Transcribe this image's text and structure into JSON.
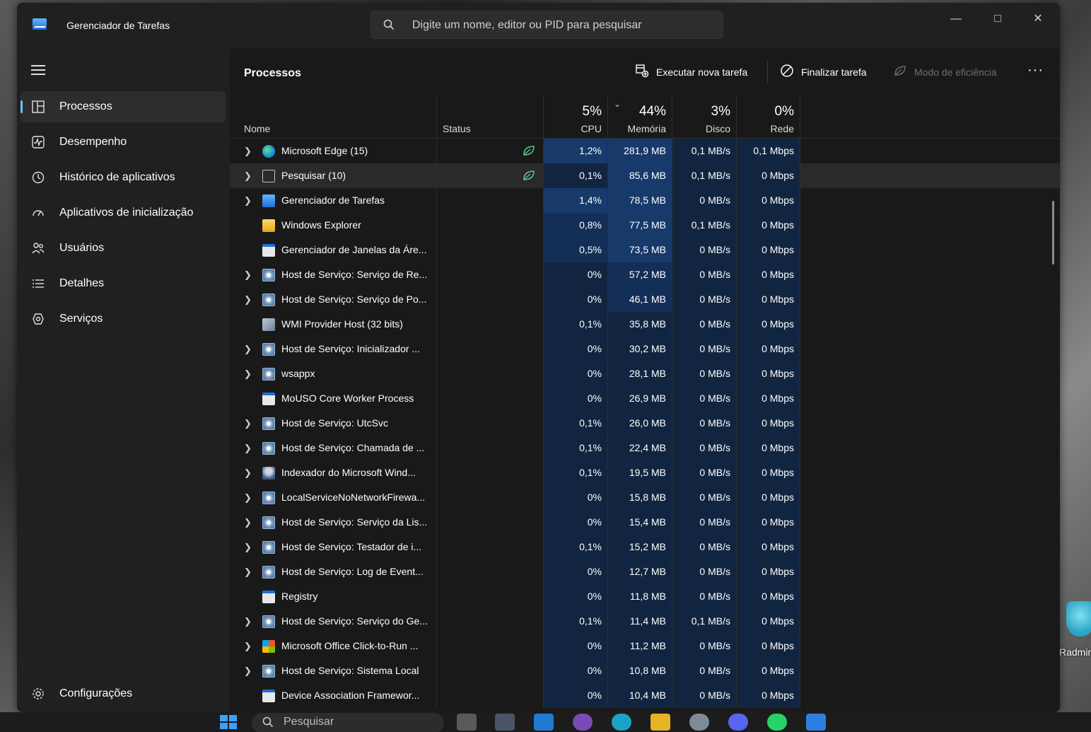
{
  "window": {
    "title": "Gerenciador de Tarefas",
    "search_placeholder": "Digite um nome, editor ou PID para pesquisar"
  },
  "sidebar": {
    "items": [
      {
        "label": "Processos",
        "icon": "grid-icon"
      },
      {
        "label": "Desempenho",
        "icon": "performance-icon"
      },
      {
        "label": "Histórico de aplicativos",
        "icon": "history-icon"
      },
      {
        "label": "Aplicativos de inicialização",
        "icon": "startup-icon"
      },
      {
        "label": "Usuários",
        "icon": "users-icon"
      },
      {
        "label": "Detalhes",
        "icon": "details-icon"
      },
      {
        "label": "Serviços",
        "icon": "services-icon"
      }
    ],
    "settings_label": "Configurações"
  },
  "toolbar": {
    "page_title": "Processos",
    "run_new_task": "Executar nova tarefa",
    "end_task": "Finalizar tarefa",
    "efficiency_mode": "Modo de eficiência",
    "more": "···"
  },
  "table": {
    "headers": {
      "name": "Nome",
      "status": "Status",
      "cpu_pct": "5%",
      "cpu": "CPU",
      "mem_pct": "44%",
      "mem": "Memória",
      "disk_pct": "3%",
      "disk": "Disco",
      "net_pct": "0%",
      "net": "Rede"
    },
    "rows": [
      {
        "expand": true,
        "icon": "edge-icon",
        "name": "Microsoft Edge (15)",
        "leaf": true,
        "cpu": "1,2%",
        "mem": "281,9 MB",
        "disk": "0,1 MB/s",
        "net": "0,1 Mbps"
      },
      {
        "expand": true,
        "icon": "search-app-icon",
        "name": "Pesquisar (10)",
        "leaf": true,
        "cpu": "0,1%",
        "mem": "85,6 MB",
        "disk": "0,1 MB/s",
        "net": "0 Mbps"
      },
      {
        "expand": true,
        "icon": "taskmgr-icon",
        "name": "Gerenciador de Tarefas",
        "leaf": false,
        "cpu": "1,4%",
        "mem": "78,5 MB",
        "disk": "0 MB/s",
        "net": "0 Mbps"
      },
      {
        "expand": false,
        "icon": "folder-icon",
        "name": "Windows Explorer",
        "leaf": false,
        "cpu": "0,8%",
        "mem": "77,5 MB",
        "disk": "0,1 MB/s",
        "net": "0 Mbps"
      },
      {
        "expand": false,
        "icon": "window-icon",
        "name": "Gerenciador de Janelas da Áre...",
        "leaf": false,
        "cpu": "0,5%",
        "mem": "73,5 MB",
        "disk": "0 MB/s",
        "net": "0 Mbps"
      },
      {
        "expand": true,
        "icon": "service-gear-icon",
        "name": "Host de Serviço: Serviço de Re...",
        "leaf": false,
        "cpu": "0%",
        "mem": "57,2 MB",
        "disk": "0 MB/s",
        "net": "0 Mbps"
      },
      {
        "expand": true,
        "icon": "service-gear-icon",
        "name": "Host de Serviço: Serviço de Po...",
        "leaf": false,
        "cpu": "0%",
        "mem": "46,1 MB",
        "disk": "0 MB/s",
        "net": "0 Mbps"
      },
      {
        "expand": false,
        "icon": "wmi-icon",
        "name": "WMI Provider Host (32 bits)",
        "leaf": false,
        "cpu": "0,1%",
        "mem": "35,8 MB",
        "disk": "0 MB/s",
        "net": "0 Mbps"
      },
      {
        "expand": true,
        "icon": "service-gear-icon",
        "name": "Host de Serviço: Inicializador ...",
        "leaf": false,
        "cpu": "0%",
        "mem": "30,2 MB",
        "disk": "0 MB/s",
        "net": "0 Mbps"
      },
      {
        "expand": true,
        "icon": "service-gear-icon",
        "name": "wsappx",
        "leaf": false,
        "cpu": "0%",
        "mem": "28,1 MB",
        "disk": "0 MB/s",
        "net": "0 Mbps"
      },
      {
        "expand": false,
        "icon": "window-icon",
        "name": "MoUSO Core Worker Process",
        "leaf": false,
        "cpu": "0%",
        "mem": "26,9 MB",
        "disk": "0 MB/s",
        "net": "0 Mbps"
      },
      {
        "expand": true,
        "icon": "service-gear-icon",
        "name": "Host de Serviço: UtcSvc",
        "leaf": false,
        "cpu": "0,1%",
        "mem": "26,0 MB",
        "disk": "0 MB/s",
        "net": "0 Mbps"
      },
      {
        "expand": true,
        "icon": "service-gear-icon",
        "name": "Host de Serviço: Chamada de ...",
        "leaf": false,
        "cpu": "0,1%",
        "mem": "22,4 MB",
        "disk": "0 MB/s",
        "net": "0 Mbps"
      },
      {
        "expand": true,
        "icon": "indexer-icon",
        "name": "Indexador do Microsoft Wind...",
        "leaf": false,
        "cpu": "0,1%",
        "mem": "19,5 MB",
        "disk": "0 MB/s",
        "net": "0 Mbps"
      },
      {
        "expand": true,
        "icon": "service-gear-icon",
        "name": "LocalServiceNoNetworkFirewa...",
        "leaf": false,
        "cpu": "0%",
        "mem": "15,8 MB",
        "disk": "0 MB/s",
        "net": "0 Mbps"
      },
      {
        "expand": true,
        "icon": "service-gear-icon",
        "name": "Host de Serviço: Serviço da Lis...",
        "leaf": false,
        "cpu": "0%",
        "mem": "15,4 MB",
        "disk": "0 MB/s",
        "net": "0 Mbps"
      },
      {
        "expand": true,
        "icon": "service-gear-icon",
        "name": "Host de Serviço: Testador de i...",
        "leaf": false,
        "cpu": "0,1%",
        "mem": "15,2 MB",
        "disk": "0 MB/s",
        "net": "0 Mbps"
      },
      {
        "expand": true,
        "icon": "service-gear-icon",
        "name": "Host de Serviço: Log de Event...",
        "leaf": false,
        "cpu": "0%",
        "mem": "12,7 MB",
        "disk": "0 MB/s",
        "net": "0 Mbps"
      },
      {
        "expand": false,
        "icon": "window-icon",
        "name": "Registry",
        "leaf": false,
        "cpu": "0%",
        "mem": "11,8 MB",
        "disk": "0 MB/s",
        "net": "0 Mbps"
      },
      {
        "expand": true,
        "icon": "service-gear-icon",
        "name": "Host de Serviço: Serviço do Ge...",
        "leaf": false,
        "cpu": "0,1%",
        "mem": "11,4 MB",
        "disk": "0,1 MB/s",
        "net": "0 Mbps"
      },
      {
        "expand": true,
        "icon": "office-icon",
        "name": "Microsoft Office Click-to-Run ...",
        "leaf": false,
        "cpu": "0%",
        "mem": "11,2 MB",
        "disk": "0 MB/s",
        "net": "0 Mbps"
      },
      {
        "expand": true,
        "icon": "service-gear-icon",
        "name": "Host de Serviço: Sistema Local",
        "leaf": false,
        "cpu": "0%",
        "mem": "10,8 MB",
        "disk": "0 MB/s",
        "net": "0 Mbps"
      },
      {
        "expand": false,
        "icon": "window-icon",
        "name": "Device Association Framewor...",
        "leaf": false,
        "cpu": "0%",
        "mem": "10,4 MB",
        "disk": "0 MB/s",
        "net": "0 Mbps"
      }
    ]
  },
  "taskbar": {
    "search_label": "Pesquisar"
  },
  "desktop": {
    "icon_label": "Radmin"
  }
}
